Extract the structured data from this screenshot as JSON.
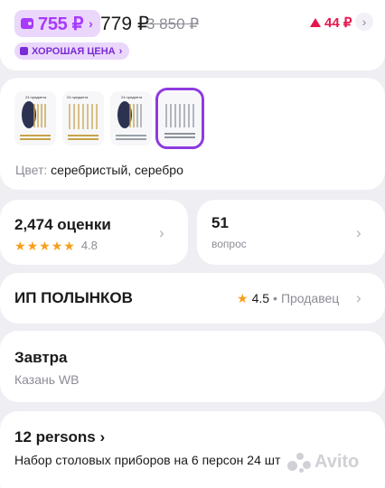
{
  "header": {
    "wallet_price": "755 ₽",
    "wallet_chevron": "›",
    "price": "779 ₽",
    "old_price": "3 850 ₽",
    "price_change": "44 ₽",
    "price_change_icon": "triangle-up-icon",
    "price_change_color": "#e5174d",
    "badge": "ХОРОШАЯ ЦЕНА",
    "badge_chevron": "›",
    "accent": "#a73afd"
  },
  "gallery": {
    "thumbnails": [
      {
        "caption": "24 предмета",
        "style": "dark-case-gold",
        "selected": false
      },
      {
        "caption": "24 предмета",
        "style": "white-gold",
        "selected": false
      },
      {
        "caption": "24 предмета",
        "style": "dark-case-gold-silver",
        "selected": false
      },
      {
        "caption": "",
        "style": "silver",
        "selected": true
      }
    ],
    "color_label": "Цвет:",
    "color_value": "серебристый, серебро"
  },
  "reviews": {
    "count": "2,474 оценки",
    "rating": "4.8",
    "stars": 5
  },
  "questions": {
    "count": "51",
    "label": "вопрос"
  },
  "seller": {
    "name": "ИП ПОЛЫНКОВ",
    "rating": "4.5",
    "separator": "•",
    "role": "Продавец"
  },
  "delivery": {
    "date": "Завтра",
    "place": "Казань WB"
  },
  "product": {
    "brand": "12 persons ›",
    "description": "Набор столовых приборов на 6 персон 24 шт"
  }
}
